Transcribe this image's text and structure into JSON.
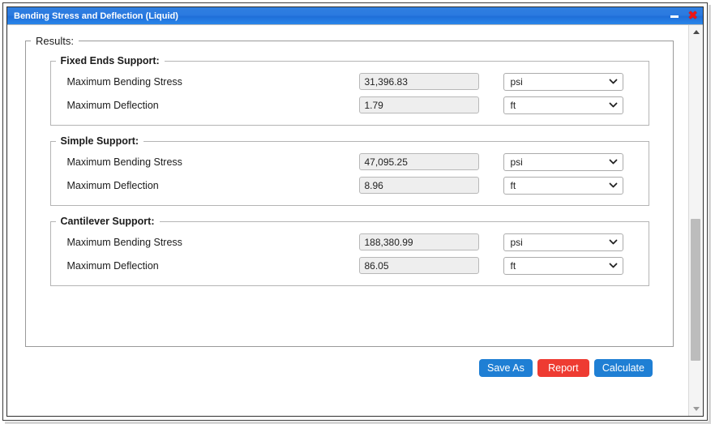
{
  "window": {
    "title": "Bending Stress and Deflection (Liquid)",
    "minimize_label": "minimize",
    "close_label": "✖"
  },
  "results": {
    "legend": "Results:",
    "groups": [
      {
        "legend": "Fixed Ends Support:",
        "rows": [
          {
            "label": "Maximum Bending Stress",
            "value": "31,396.83",
            "unit": "psi"
          },
          {
            "label": "Maximum Deflection",
            "value": "1.79",
            "unit": "ft"
          }
        ]
      },
      {
        "legend": "Simple Support:",
        "rows": [
          {
            "label": "Maximum Bending Stress",
            "value": "47,095.25",
            "unit": "psi"
          },
          {
            "label": "Maximum Deflection",
            "value": "8.96",
            "unit": "ft"
          }
        ]
      },
      {
        "legend": "Cantilever Support:",
        "rows": [
          {
            "label": "Maximum Bending Stress",
            "value": "188,380.99",
            "unit": "psi"
          },
          {
            "label": "Maximum Deflection",
            "value": "86.05",
            "unit": "ft"
          }
        ]
      }
    ]
  },
  "footer": {
    "save_as_label": "Save As",
    "report_label": "Report",
    "calculate_label": "Calculate"
  },
  "colors": {
    "title_bar_blue": "#2b7ae0",
    "button_blue": "#1f7fd4",
    "button_red": "#ee3b32",
    "close_red": "#f01414",
    "value_box_bg": "#eeeeee"
  },
  "scrollbar": {
    "up_arrow_icon": "triangle-up-icon",
    "down_arrow_icon": "triangle-down-icon"
  }
}
